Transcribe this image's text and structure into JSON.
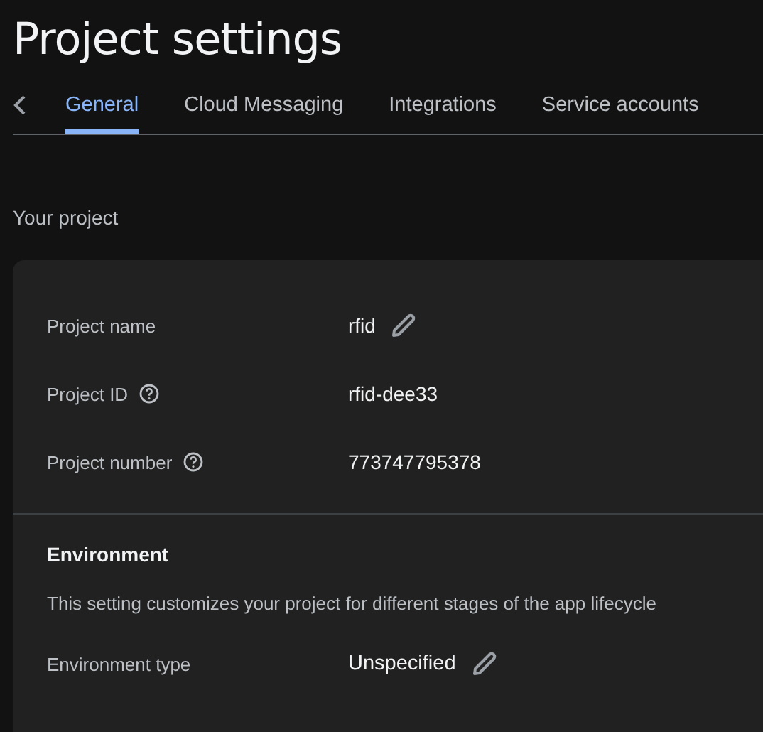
{
  "title": "Project settings",
  "tabs": [
    {
      "label": "General",
      "selected": true
    },
    {
      "label": "Cloud Messaging",
      "selected": false
    },
    {
      "label": "Integrations",
      "selected": false
    },
    {
      "label": "Service accounts",
      "selected": false
    }
  ],
  "section_title": "Your project",
  "project_rows": [
    {
      "label": "Project name",
      "value": "rfid",
      "help": false,
      "editable": true
    },
    {
      "label": "Project ID",
      "value": "rfid-dee33",
      "help": true,
      "editable": false
    },
    {
      "label": "Project number",
      "value": "773747795378",
      "help": true,
      "editable": false
    }
  ],
  "environment": {
    "title": "Environment",
    "description": "This setting customizes your project for different stages of the app lifecycle",
    "label": "Environment type",
    "value": "Unspecified",
    "editable": true
  }
}
